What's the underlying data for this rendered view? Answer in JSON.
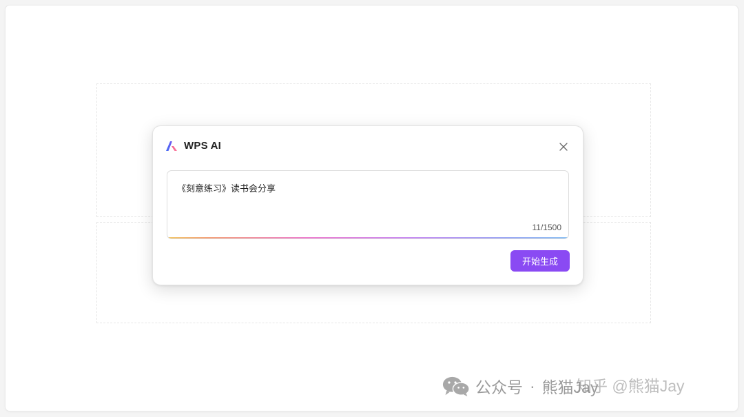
{
  "dialog": {
    "title": "WPS AI",
    "prompt_value": "《刻意练习》读书会分享",
    "char_counter": "11/1500",
    "generate_label": "开始生成"
  },
  "watermark": {
    "account": "公众号",
    "separator": "·",
    "author": "熊猫Jay",
    "overlay": "知乎 @熊猫Jay"
  },
  "colors": {
    "primary_button": "#8a4af3",
    "input_gradient": [
      "#f3c96b",
      "#ee7fd0",
      "#c98cf3",
      "#8fc3f4"
    ]
  },
  "icons": {
    "logo": "wps-ai-logo-icon",
    "close": "close-icon",
    "watermark": "wechat-icon"
  }
}
